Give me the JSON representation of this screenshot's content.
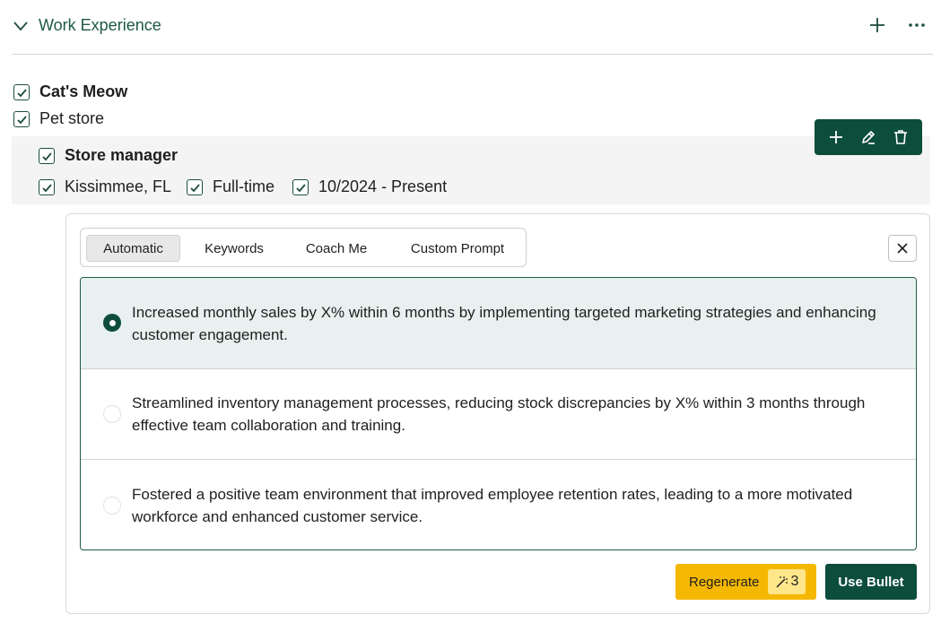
{
  "section": {
    "title": "Work Experience",
    "icons": {
      "collapse": "chevron-down-icon",
      "add": "plus-icon",
      "more": "more-icon"
    }
  },
  "company": {
    "name": "Cat's Meow",
    "description": "Pet store"
  },
  "role": {
    "title": "Store manager",
    "location": "Kissimmee, FL",
    "type": "Full-time",
    "dates": "10/2024 - Present",
    "toolbar_icons": [
      "plus-icon",
      "pencil-icon",
      "trash-icon"
    ]
  },
  "generator": {
    "tabs": [
      {
        "label": "Automatic",
        "active": true
      },
      {
        "label": "Keywords",
        "active": false
      },
      {
        "label": "Coach Me",
        "active": false
      },
      {
        "label": "Custom Prompt",
        "active": false
      }
    ],
    "options": [
      {
        "text": "Increased monthly sales by X% within 6 months by implementing targeted marketing strategies and enhancing customer engagement.",
        "selected": true
      },
      {
        "text": "Streamlined inventory management processes, reducing stock discrepancies by X% within 3 months through effective team collaboration and training.",
        "selected": false
      },
      {
        "text": "Fostered a positive team environment that improved employee retention rates, leading to a more motivated workforce and enhanced customer service.",
        "selected": false
      }
    ],
    "regenerate_label": "Regenerate",
    "regenerate_count": "3",
    "use_label": "Use Bullet"
  },
  "colors": {
    "brand": "#0d4d3c",
    "accent": "#f5b800",
    "selected_bg": "#e8f1f0"
  }
}
